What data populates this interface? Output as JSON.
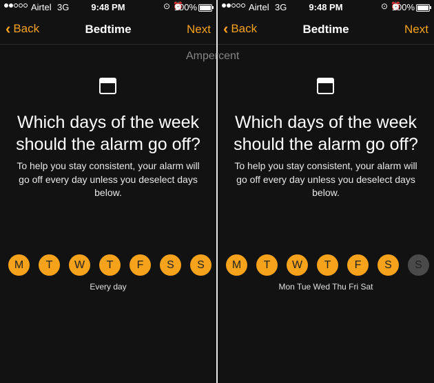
{
  "status": {
    "carrier": "Airtel",
    "network": "3G",
    "time": "9:48 PM",
    "battery": "100%",
    "signal_dots_filled": 2,
    "signal_dots_total": 5
  },
  "nav": {
    "back_label": "Back",
    "title": "Bedtime",
    "next_label": "Next"
  },
  "watermark": "Ampercent",
  "question": "Which days of the week should the alarm go off?",
  "description": "To help you stay consistent, your alarm will go off every day unless you deselect days below.",
  "colors": {
    "accent": "#f7a21b",
    "deselected": "#4a4a4a"
  },
  "screens": [
    {
      "days": [
        {
          "label": "M",
          "selected": true
        },
        {
          "label": "T",
          "selected": true
        },
        {
          "label": "W",
          "selected": true
        },
        {
          "label": "T",
          "selected": true
        },
        {
          "label": "F",
          "selected": true
        },
        {
          "label": "S",
          "selected": true
        },
        {
          "label": "S",
          "selected": true
        }
      ],
      "summary": "Every day"
    },
    {
      "days": [
        {
          "label": "M",
          "selected": true
        },
        {
          "label": "T",
          "selected": true
        },
        {
          "label": "W",
          "selected": true
        },
        {
          "label": "T",
          "selected": true
        },
        {
          "label": "F",
          "selected": true
        },
        {
          "label": "S",
          "selected": true
        },
        {
          "label": "S",
          "selected": false
        }
      ],
      "summary": "Mon Tue Wed Thu Fri Sat"
    }
  ]
}
